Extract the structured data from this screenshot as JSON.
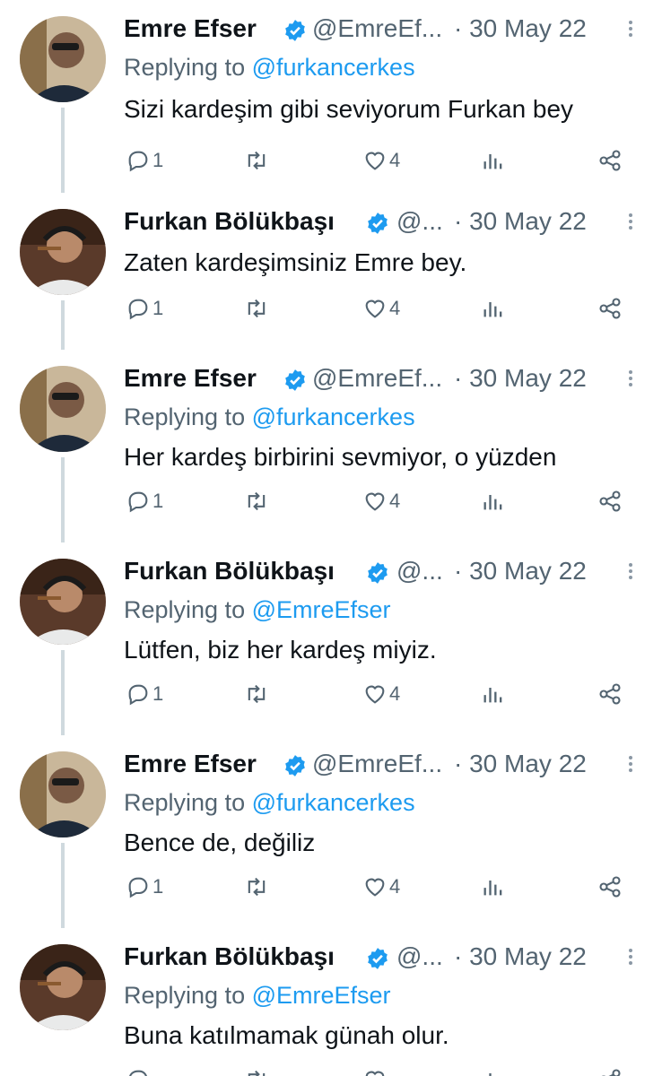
{
  "tweets": [
    {
      "name": "Emre Efser",
      "handle": "@EmreEf...",
      "date": "· 30 May 22",
      "reply_label": "Replying to ",
      "reply_to": "@furkancerkes",
      "text": "Sizi kardeşim gibi seviyorum Furkan bey",
      "replies": "1",
      "likes": "4",
      "avatar": "emre"
    },
    {
      "name": "Furkan Bölükbaşı",
      "handle": "@...",
      "date": "· 30 May 22",
      "reply_label": "",
      "reply_to": "",
      "text": "Zaten kardeşimsiniz Emre bey.",
      "replies": "1",
      "likes": "4",
      "avatar": "furkan"
    },
    {
      "name": "Emre Efser",
      "handle": "@EmreEf...",
      "date": "· 30 May 22",
      "reply_label": "Replying to ",
      "reply_to": "@furkancerkes",
      "text": "Her kardeş birbirini sevmiyor, o yüzden",
      "replies": "1",
      "likes": "4",
      "avatar": "emre"
    },
    {
      "name": "Furkan Bölükbaşı",
      "handle": "@...",
      "date": "· 30 May 22",
      "reply_label": "Replying to ",
      "reply_to": "@EmreEfser",
      "text": "Lütfen, biz her kardeş miyiz.",
      "replies": "1",
      "likes": "4",
      "avatar": "furkan"
    },
    {
      "name": "Emre Efser",
      "handle": "@EmreEf...",
      "date": "· 30 May 22",
      "reply_label": "Replying to ",
      "reply_to": "@furkancerkes",
      "text": "Bence de, değiliz",
      "replies": "1",
      "likes": "4",
      "avatar": "emre"
    },
    {
      "name": "Furkan Bölükbaşı",
      "handle": "@...",
      "date": "· 30 May 22",
      "reply_label": "Replying to ",
      "reply_to": "@EmreEfser",
      "text": "Buna katılmamak günah olur.",
      "replies": "",
      "likes": "",
      "avatar": "furkan"
    }
  ],
  "icons": {
    "reply": "reply-icon",
    "retweet": "retweet-icon",
    "like": "heart-icon",
    "views": "views-icon",
    "share": "share-icon",
    "verified": "verified-badge-icon",
    "more": "more-icon"
  },
  "colors": {
    "link": "#1d9bf0",
    "secondary": "#536471",
    "thread_line": "#cfd9de"
  }
}
